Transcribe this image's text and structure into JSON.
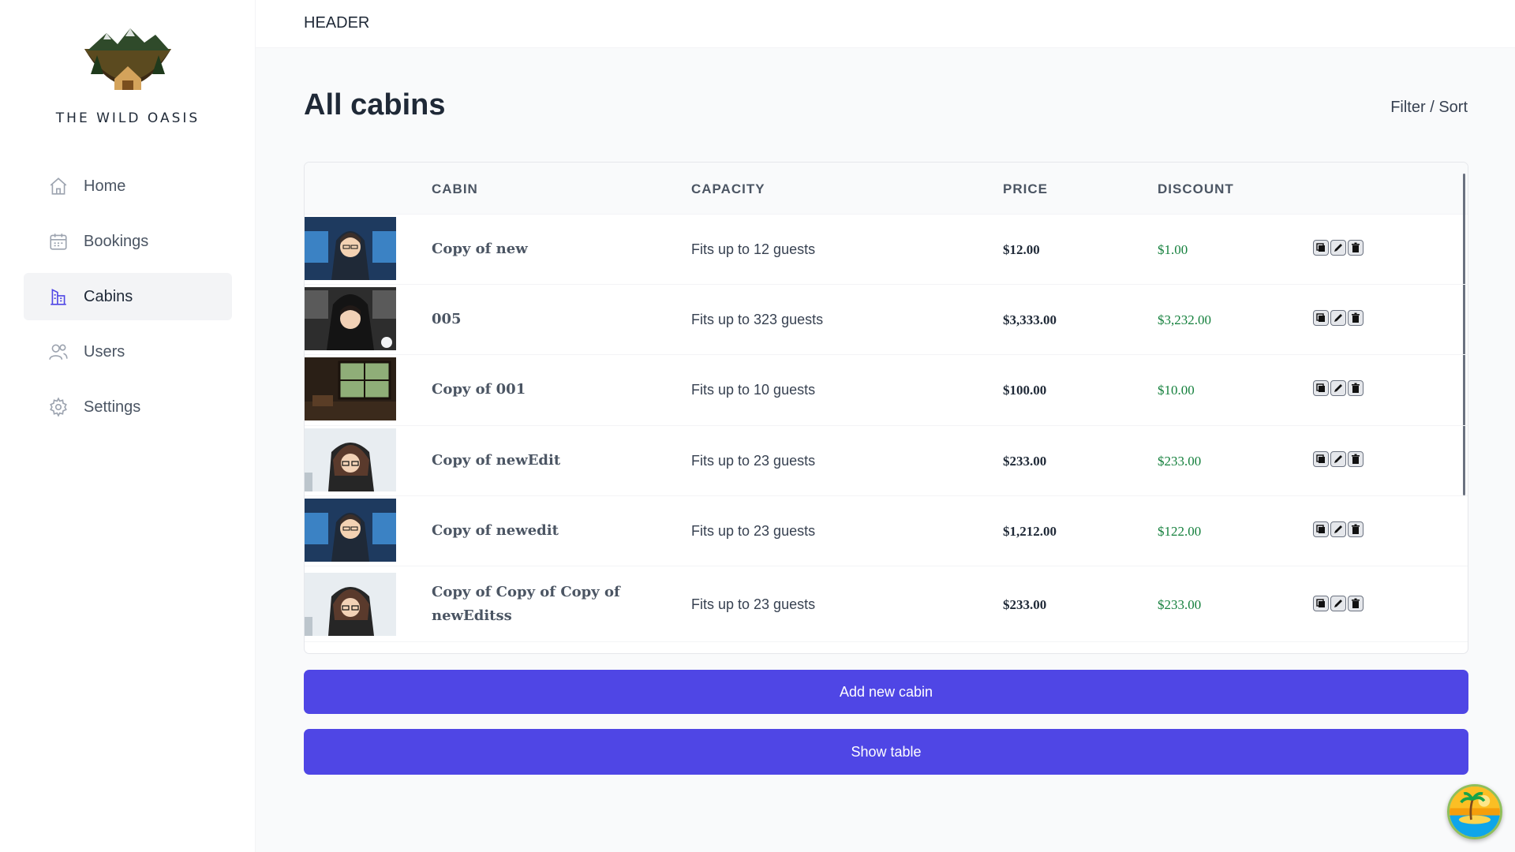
{
  "sidebar": {
    "logo_text": "THE WILD OASIS",
    "items": [
      {
        "label": "Home",
        "icon": "home-icon",
        "active": false
      },
      {
        "label": "Bookings",
        "icon": "calendar-icon",
        "active": false
      },
      {
        "label": "Cabins",
        "icon": "building-icon",
        "active": true
      },
      {
        "label": "Users",
        "icon": "users-icon",
        "active": false
      },
      {
        "label": "Settings",
        "icon": "gear-icon",
        "active": false
      }
    ]
  },
  "header": {
    "title": "HEADER"
  },
  "main": {
    "title": "All cabins",
    "filter_sort": "Filter / Sort",
    "table": {
      "columns": [
        "CABIN",
        "CAPACITY",
        "PRICE",
        "DISCOUNT"
      ],
      "rows": [
        {
          "name": "Copy of new",
          "capacity": "Fits up to 12 guests",
          "price": "$12.00",
          "discount": "$1.00",
          "image": "anime-hood-desk"
        },
        {
          "name": "005",
          "capacity": "Fits up to 323 guests",
          "price": "$3,333.00",
          "discount": "$3,232.00",
          "image": "anime-hood-dark"
        },
        {
          "name": "Copy of 001",
          "capacity": "Fits up to 10 guests",
          "price": "$100.00",
          "discount": "$10.00",
          "image": "cabin-interior"
        },
        {
          "name": "Copy of newEdit",
          "capacity": "Fits up to 23 guests",
          "price": "$233.00",
          "discount": "$233.00",
          "image": "anime-glasses"
        },
        {
          "name": "Copy of newedit",
          "capacity": "Fits up to 23 guests",
          "price": "$1,212.00",
          "discount": "$122.00",
          "image": "anime-hood-desk"
        },
        {
          "name": "Copy of Copy of Copy of newEditss",
          "capacity": "Fits up to 23 guests",
          "price": "$233.00",
          "discount": "$233.00",
          "image": "anime-glasses"
        }
      ],
      "action_icons": [
        "duplicate-icon",
        "edit-icon",
        "delete-icon"
      ]
    },
    "add_button": "Add new cabin",
    "show_table_button": "Show table"
  },
  "colors": {
    "accent": "#4f46e5",
    "discount": "#15803d",
    "background": "#f9fafb"
  }
}
